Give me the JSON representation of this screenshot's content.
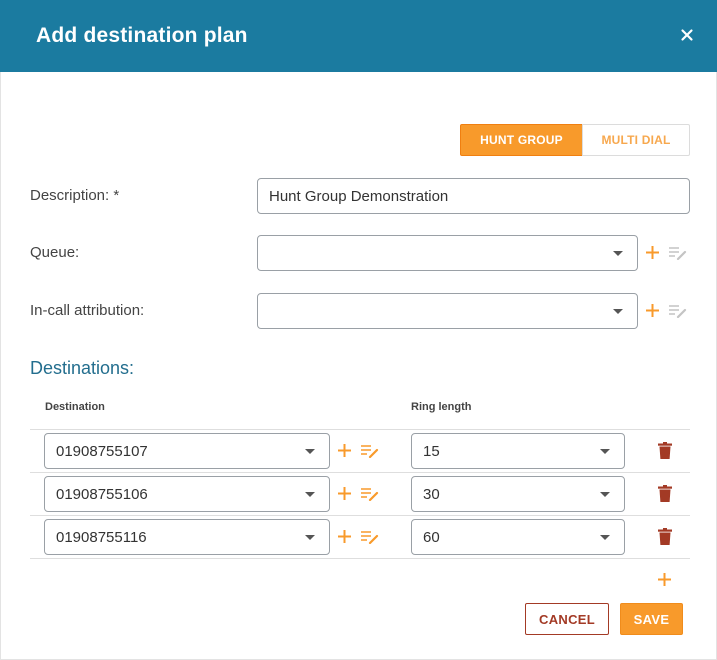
{
  "dialog": {
    "title": "Add destination plan",
    "close_icon": "close-icon",
    "colors": {
      "header": "#1b7ba0",
      "accent": "#f89a2b",
      "danger": "#a33a25"
    }
  },
  "mode_toggle": {
    "options": [
      "HUNT GROUP",
      "MULTI DIAL"
    ],
    "selected": "HUNT GROUP"
  },
  "form": {
    "description": {
      "label": "Description: *",
      "value": "Hunt Group Demonstration"
    },
    "queue": {
      "label": "Queue:",
      "value": ""
    },
    "incall_attribution": {
      "label": "In-call attribution:",
      "value": ""
    }
  },
  "destinations": {
    "title": "Destinations:",
    "columns": {
      "destination": "Destination",
      "ring_length": "Ring length"
    },
    "rows": [
      {
        "destination": "01908755107",
        "ring_length": "15"
      },
      {
        "destination": "01908755106",
        "ring_length": "30"
      },
      {
        "destination": "01908755116",
        "ring_length": "60"
      }
    ]
  },
  "actions": {
    "cancel": "CANCEL",
    "save": "SAVE"
  }
}
